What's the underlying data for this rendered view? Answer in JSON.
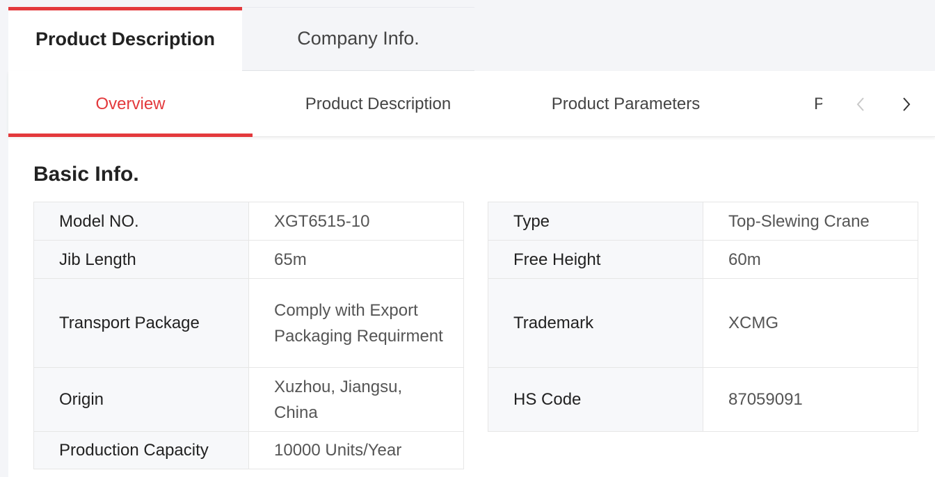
{
  "top_tabs": [
    {
      "label": "Product Description",
      "active": true
    },
    {
      "label": "Company Info.",
      "active": false
    }
  ],
  "sub_nav": {
    "tabs": [
      {
        "label": "Overview",
        "active": true
      },
      {
        "label": "Product Description",
        "active": false
      },
      {
        "label": "Product Parameters",
        "active": false
      }
    ],
    "overflow_tab_label": "P",
    "prev_icon": "chevron-left-icon",
    "next_icon": "chevron-right-icon"
  },
  "basic_info": {
    "title": "Basic Info.",
    "left": [
      {
        "label": "Model NO.",
        "value": "XGT6515-10"
      },
      {
        "label": "Jib Length",
        "value": "65m"
      },
      {
        "label": "Transport Package",
        "value": "Comply with Export Packaging Requirment"
      },
      {
        "label": "Origin",
        "value": "Xuzhou, Jiangsu, China"
      },
      {
        "label": "Production Capacity",
        "value": "10000 Units/Year"
      }
    ],
    "right": [
      {
        "label": "Type",
        "value": "Top-Slewing Crane"
      },
      {
        "label": "Free Height",
        "value": "60m"
      },
      {
        "label": "Trademark",
        "value": "XCMG"
      },
      {
        "label": "HS Code",
        "value": "87059091"
      }
    ]
  },
  "colors": {
    "accent": "#e3393c",
    "page_background": "#f4f5f8",
    "label_background": "#f7f8fa"
  }
}
